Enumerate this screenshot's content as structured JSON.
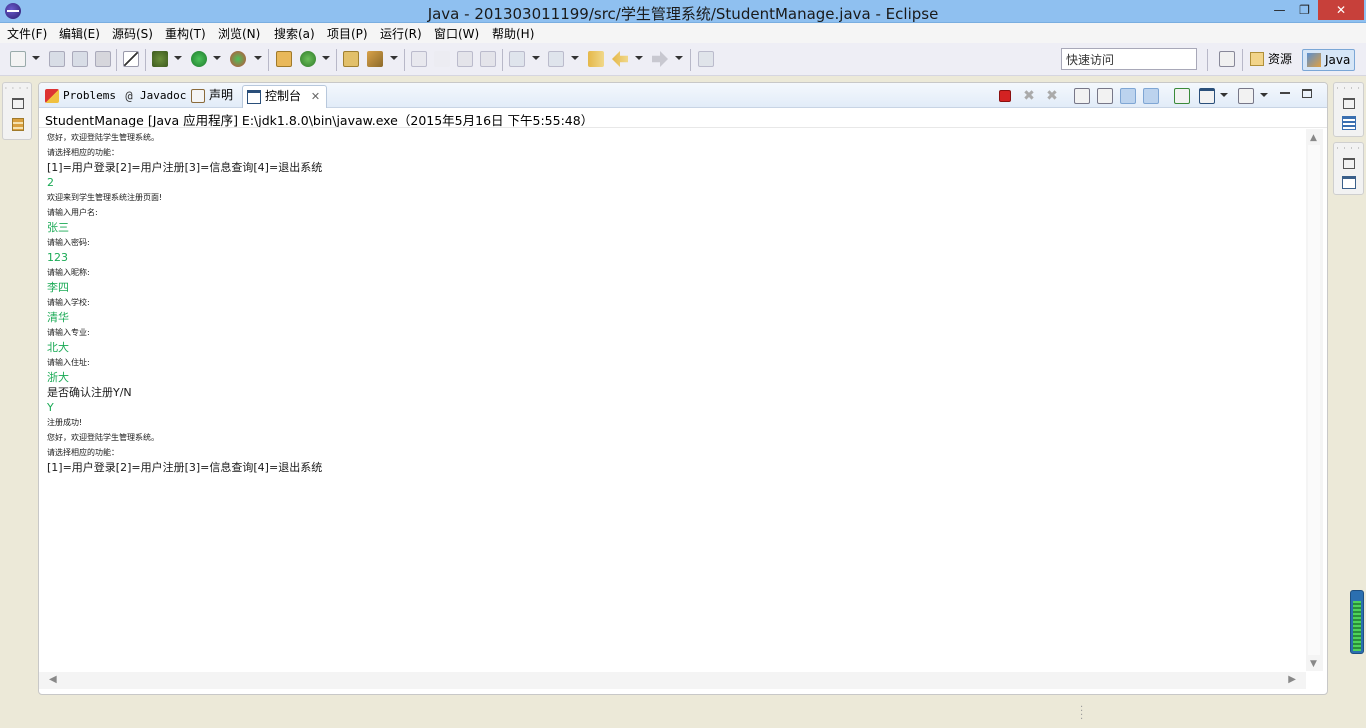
{
  "window": {
    "title": "Java  -  201303011199/src/学生管理系统/StudentManage.java  -  Eclipse",
    "min_glyph": "—",
    "max_glyph": "❐",
    "close_glyph": "✕"
  },
  "menu": [
    "文件(F)",
    "编辑(E)",
    "源码(S)",
    "重构(T)",
    "浏览(N)",
    "搜索(a)",
    "项目(P)",
    "运行(R)",
    "窗口(W)",
    "帮助(H)"
  ],
  "quick_access": {
    "value": "快速访问"
  },
  "perspectives": {
    "resource": "资源",
    "java": "Java"
  },
  "tabs": [
    {
      "label": "Problems",
      "icon": "problems-icon"
    },
    {
      "label": "Javadoc",
      "icon": "at-icon"
    },
    {
      "label": "声明",
      "icon": "declaration-icon"
    },
    {
      "label": "控制台",
      "icon": "console-icon",
      "active": true
    }
  ],
  "console": {
    "header": "StudentManage [Java 应用程序] E:\\jdk1.8.0\\bin\\javaw.exe（2015年5月16日 下午5:55:48）",
    "lines": [
      {
        "text": "您好，欢迎登陆学生管理系统。",
        "kind": "out"
      },
      {
        "text": "请选择相应的功能：",
        "kind": "out"
      },
      {
        "text": "[1]=用户登录[2]=用户注册[3]=信息查询[4]=退出系统",
        "kind": "out-big"
      },
      {
        "text": "2",
        "kind": "input"
      },
      {
        "text": "欢迎来到学生管理系统注册页面!",
        "kind": "out"
      },
      {
        "text": "请输入用户名:",
        "kind": "out"
      },
      {
        "text": "张三",
        "kind": "input"
      },
      {
        "text": "请输入密码:",
        "kind": "out"
      },
      {
        "text": "123",
        "kind": "input"
      },
      {
        "text": "请输入昵称:",
        "kind": "out"
      },
      {
        "text": "李四",
        "kind": "input"
      },
      {
        "text": "请输入学校:",
        "kind": "out"
      },
      {
        "text": "清华",
        "kind": "input"
      },
      {
        "text": "请输入专业:",
        "kind": "out"
      },
      {
        "text": "北大",
        "kind": "input"
      },
      {
        "text": "请输入住址:",
        "kind": "out"
      },
      {
        "text": "浙大",
        "kind": "input"
      },
      {
        "text": "是否确认注册Y/N",
        "kind": "out-big"
      },
      {
        "text": "Y",
        "kind": "input"
      },
      {
        "text": "注册成功!",
        "kind": "out"
      },
      {
        "text": "您好，欢迎登陆学生管理系统。",
        "kind": "out"
      },
      {
        "text": "请选择相应的功能：",
        "kind": "out"
      },
      {
        "text": "[1]=用户登录[2]=用户注册[3]=信息查询[4]=退出系统",
        "kind": "out-big"
      }
    ]
  },
  "colors": {
    "input_text": "#1aaa55",
    "terminate_red": "#d32222",
    "title_bar": "#8fc0f0"
  }
}
